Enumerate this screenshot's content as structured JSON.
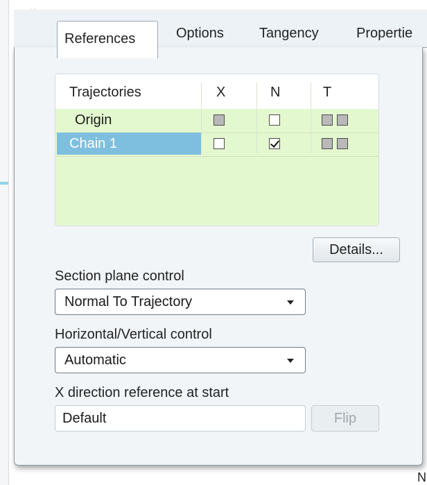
{
  "tabs": [
    {
      "label": "References",
      "active": true
    },
    {
      "label": "Options"
    },
    {
      "label": "Tangency"
    },
    {
      "label": "Propertie"
    }
  ],
  "trajectories": {
    "headers": [
      "Trajectories",
      "X",
      "N",
      "T"
    ],
    "rows": [
      {
        "name": "Origin",
        "x": "gray",
        "n": "unchecked",
        "t": [
          "gray",
          "gray"
        ],
        "selected": false
      },
      {
        "name": "Chain 1",
        "x": "unchecked",
        "n": "checked",
        "t": [
          "gray",
          "gray"
        ],
        "selected": true
      }
    ]
  },
  "details_button": "Details...",
  "section_plane": {
    "label": "Section plane control",
    "value": "Normal To Trajectory"
  },
  "hv_control": {
    "label": "Horizontal/Vertical control",
    "value": "Automatic"
  },
  "x_direction": {
    "label": "X direction reference at start",
    "value": "Default"
  },
  "flip_button": "Flip",
  "corner_char": "N",
  "colors": {
    "selection": "#7ebfe0",
    "table_body": "#e4f8cf",
    "panel": "#f1f5f8"
  }
}
